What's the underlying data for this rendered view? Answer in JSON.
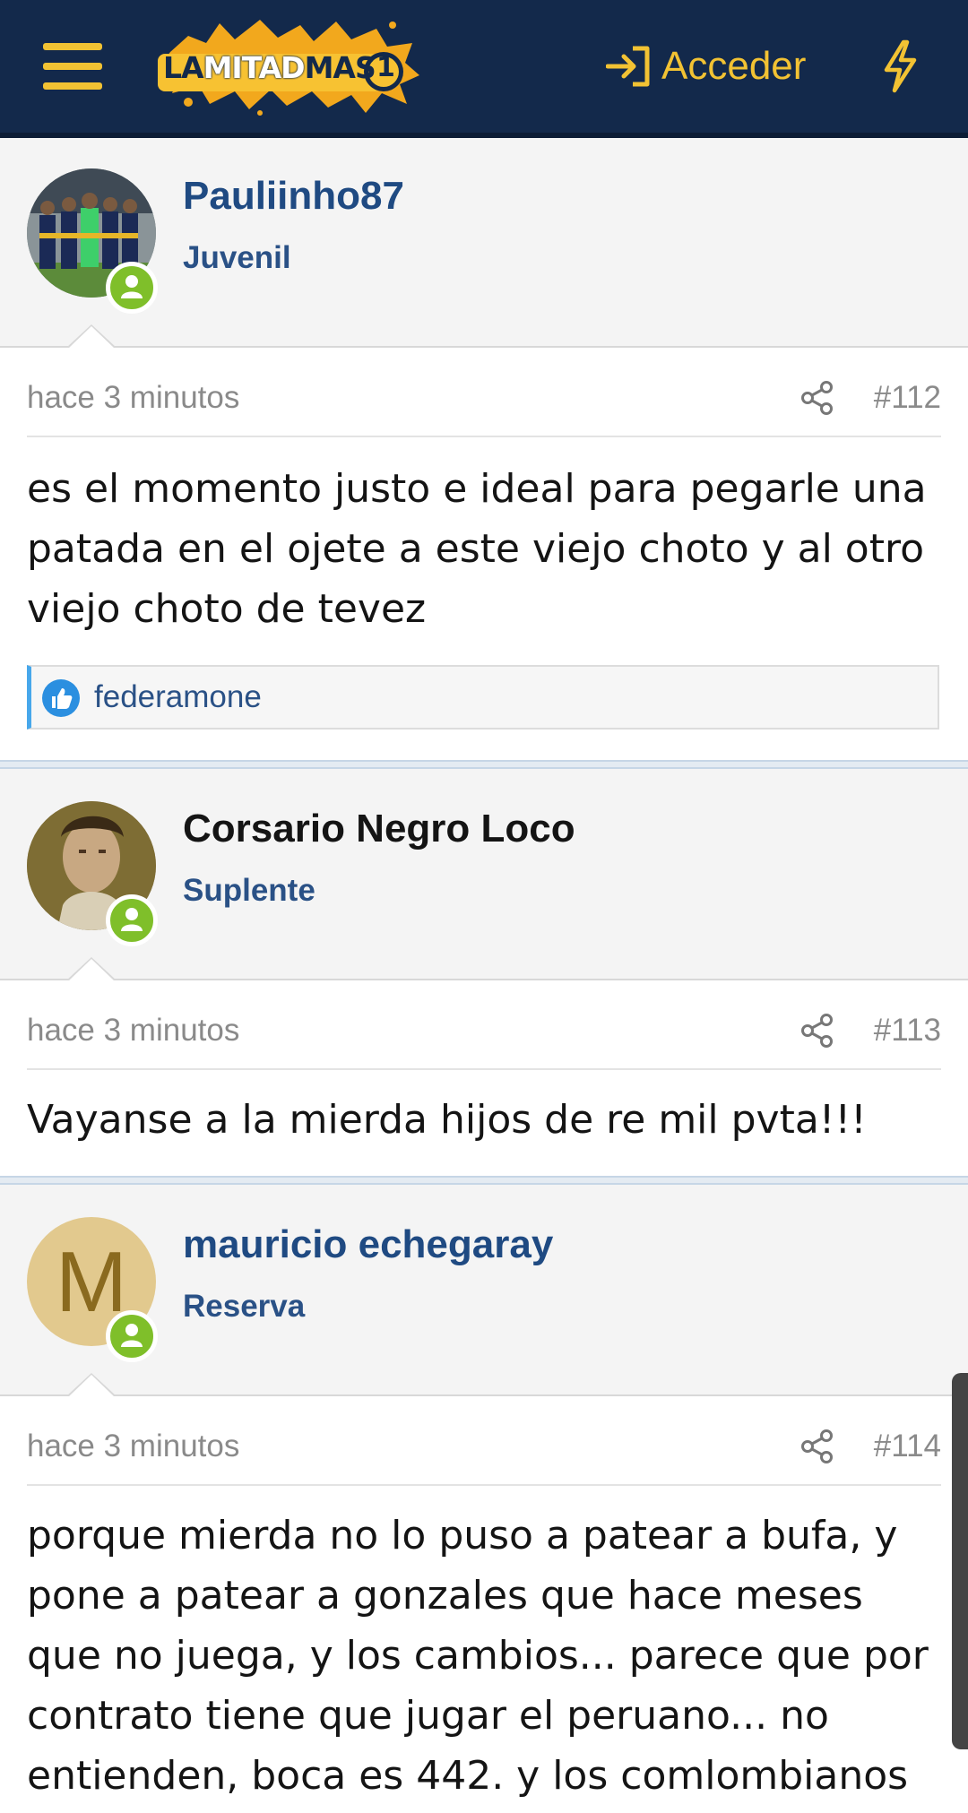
{
  "header": {
    "logo_text_dark": "LA",
    "logo_text_light": "MITAD",
    "logo_text_dark2": "MAS",
    "logo_text_num": "1",
    "login_label": "Acceder",
    "menu_icon": "hamburger-icon",
    "login_icon": "sign-in-icon",
    "whats_new_icon": "lightning-bolt-icon"
  },
  "posts": [
    {
      "username": "Pauliinho87",
      "role": "Juvenil",
      "time": "hace 3 minutos",
      "number": "#112",
      "text": "es el momento justo e ideal para pegarle una patada en el ojete a este viejo choto y al otro viejo choto de tevez",
      "reactions": "federamone"
    },
    {
      "username": "Corsario Negro Loco",
      "role": "Suplente",
      "time": "hace 3 minutos",
      "number": "#113",
      "text": "Vayanse a la mierda hijos de re mil pvta!!!"
    },
    {
      "username": "mauricio echegaray",
      "avatar_letter": "M",
      "role": "Reserva",
      "time": "hace 3 minutos",
      "number": "#114",
      "text": "porque mierda no lo puso a patear a bufa, y pone a patear a gonzales que hace meses que no juega, y los cambios... parece que por contrato tiene que jugar el peruano... no entienden, boca es 442. y los comlombianos"
    }
  ],
  "colors": {
    "header_bg": "#13294b",
    "accent_yellow": "#f2c233",
    "link_blue": "#2a5186",
    "online_green": "#7fbf2a"
  }
}
